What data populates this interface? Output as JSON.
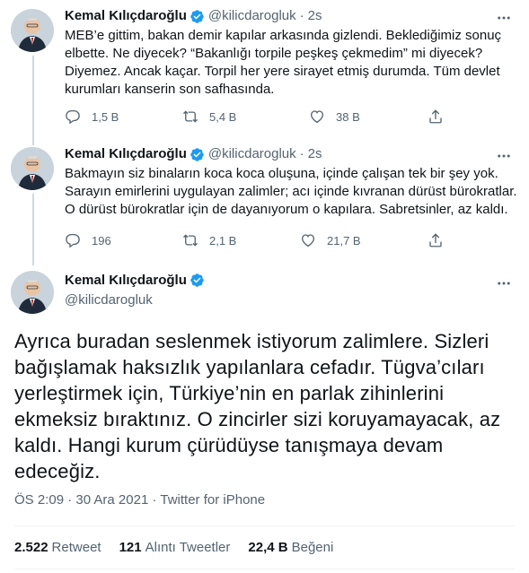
{
  "colors": {
    "text": "#0f1419",
    "muted": "#536471",
    "verified": "#1d9bf0",
    "divider": "#eff3f4"
  },
  "tweets": [
    {
      "name": "Kemal Kılıçdaroğlu",
      "handle": "@kilicdarogluk",
      "separator": "·",
      "time": "2s",
      "lines": [
        "MEB’e gittim, bakan demir kapılar arkasında gizlendi. Beklediğimiz sonuç",
        "elbette. Ne diyecek? “Bakanlığı torpile peşkeş çekmedim” mi diyecek?",
        "Diyemez. Ancak kaçar. Torpil her yere sirayet etmiş durumda. Tüm devlet",
        "kurumları kanserin son safhasında."
      ],
      "replies": "1,5 B",
      "retweets": "5,4 B",
      "likes": "38 B"
    },
    {
      "name": "Kemal Kılıçdaroğlu",
      "handle": "@kilicdarogluk",
      "separator": "·",
      "time": "2s",
      "lines": [
        "Bakmayın siz binaların koca koca oluşuna, içinde çalışan tek bir şey yok.",
        "Sarayın emirlerini uygulayan zalimler; acı içinde kıvranan dürüst bürokratlar.",
        "O dürüst bürokratlar için de dayanıyorum o kapılara. Sabretsinler, az kaldı."
      ],
      "replies": "196",
      "retweets": "2,1 B",
      "likes": "21,7 B"
    }
  ],
  "main_tweet": {
    "name": "Kemal Kılıçdaroğlu",
    "handle": "@kilicdarogluk",
    "lines": [
      "Ayrıca buradan seslenmek istiyorum zalimlere. Sizleri",
      "bağışlamak haksızlık yapılanlara cefadır. Tügva’cıları",
      "yerleştirmek için, Türkiye’nin en parlak zihinlerini",
      "ekmeksiz bıraktınız. O zincirler sizi koruyamayacak, az",
      "kaldı. Hangi kurum çürüdüyse tanışmaya devam",
      "edeceğiz."
    ],
    "time": "ÖS 2:09",
    "date": "30 Ara 2021",
    "separator": "·",
    "source": "Twitter for iPhone",
    "retweets": "2.522",
    "retweets_label": "Retweet",
    "quotes": "121",
    "quotes_label": "Alıntı Tweetler",
    "likes": "22,4 B",
    "likes_label": "Beğeni"
  }
}
